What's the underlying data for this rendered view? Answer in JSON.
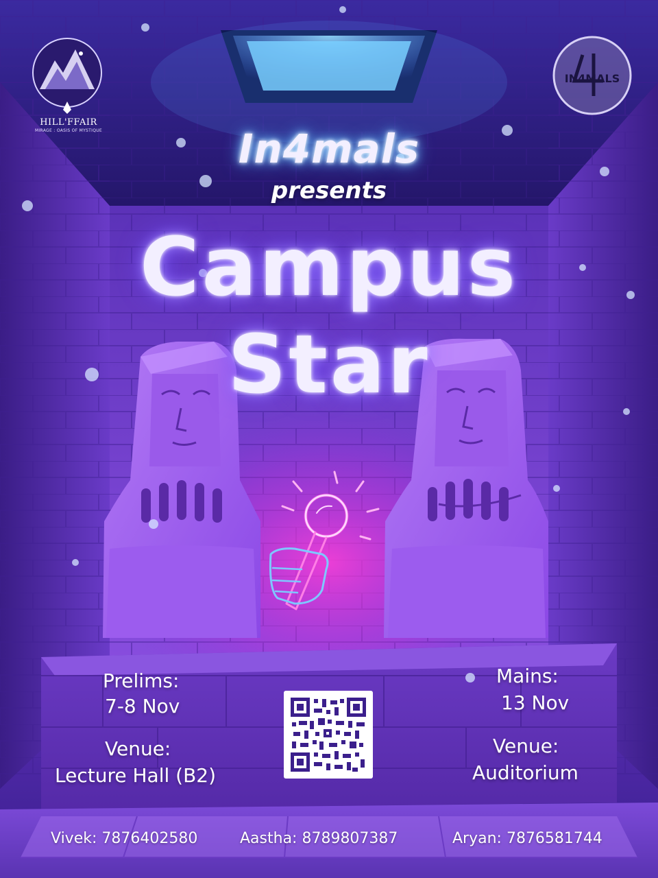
{
  "colors": {
    "background_top": "#2a1566",
    "background_mid": "#5a2fb4",
    "stone": "#a86cf2",
    "stone_dark": "#6a3bc4",
    "neon_pink": "#ff3dd6",
    "neon_blue": "#7ec8ff",
    "text": "#ffffff"
  },
  "logos": {
    "hillffair": {
      "name": "HILL'FFAIR",
      "tagline": "MIRAGE : OASIS OF MYSTIQUE",
      "icon": "mountain-logo-icon"
    },
    "in4mals": {
      "text": "IN4MALS",
      "icon": "in4mals-badge-icon"
    }
  },
  "header": {
    "brand": "In4mals",
    "presents": "presents"
  },
  "title": {
    "line1": "Campus",
    "line2": "Star"
  },
  "icons": {
    "microphone": "neon-microphone-hand-icon",
    "statues": "statue-icon",
    "qr": "qr-code-icon"
  },
  "prelims": {
    "label": "Prelims:",
    "date": "7-8 Nov",
    "venue_label": "Venue:",
    "venue": "Lecture Hall (B2)"
  },
  "mains": {
    "label": "Mains:",
    "date": "13 Nov",
    "venue_label": "Venue:",
    "venue": "Auditorium"
  },
  "contacts": [
    "Vivek: 7876402580",
    "Aastha: 8789807387",
    "Aryan: 7876581744"
  ]
}
